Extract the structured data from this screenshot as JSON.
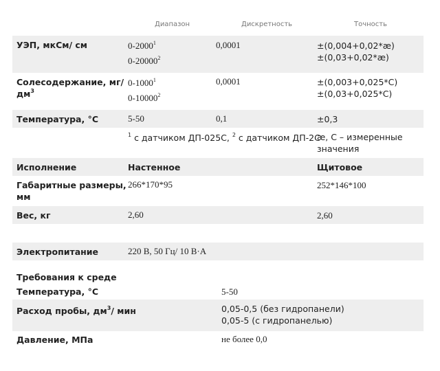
{
  "header": {
    "range": "Диапазон",
    "discreteness": "Дискретность",
    "accuracy": "Точность"
  },
  "uep": {
    "label": "УЭП, мкСм/ см",
    "range1": "0-2000",
    "range1_sup": "1",
    "range2": "0-20000",
    "range2_sup": "2",
    "discreteness": "0,0001",
    "acc1": "±(0,004+0,02*æ)",
    "acc2": "±(0,03+0,02*æ)"
  },
  "salt": {
    "label": "Солесодержание, мг/",
    "label2": "дм",
    "label2_sup": "3",
    "range1": "0-1000",
    "range1_sup": "1",
    "range2": "0-10000",
    "range2_sup": "2",
    "discreteness": "0,0001",
    "acc1": "±(0,003+0,025*C)",
    "acc2": "±(0,03+0,025*C)"
  },
  "temp": {
    "label": "Температура, °С",
    "range": "5-50",
    "discreteness": "0,1",
    "accuracy": "±0,3"
  },
  "notes": {
    "sup1": "1",
    "text1": " с датчиком ДП-025С, ",
    "sup2": "2",
    "text2": " с датчиком ДП-2С",
    "right1": "æ, С – измеренные",
    "right2": "значения"
  },
  "execution": {
    "label": "Исполнение",
    "wall": "Настенное",
    "panel": "Щитовое"
  },
  "dimensions": {
    "label1": "Габаритные размеры,",
    "label2": "мм",
    "wall": "266*170*95",
    "panel": "252*146*100"
  },
  "weight": {
    "label": "Вес, кг",
    "wall": "2,60",
    "panel": "2,60"
  },
  "power": {
    "label": "Электропитание",
    "value": "220 В, 50 Гц/ 10 В·А"
  },
  "env": {
    "title": "Требования к среде",
    "temp_label": "Температура, °С",
    "temp_value": "5-50",
    "flow_label": "Расход пробы, дм",
    "flow_label_sup": "3",
    "flow_label_tail": "/ мин",
    "flow_value1": "0,05-0,5 (без гидропанели)",
    "flow_value2": "0,05-5 (с гидропанелью)",
    "pressure_label": "Давление, МПа",
    "pressure_value": "не более 0,0"
  }
}
